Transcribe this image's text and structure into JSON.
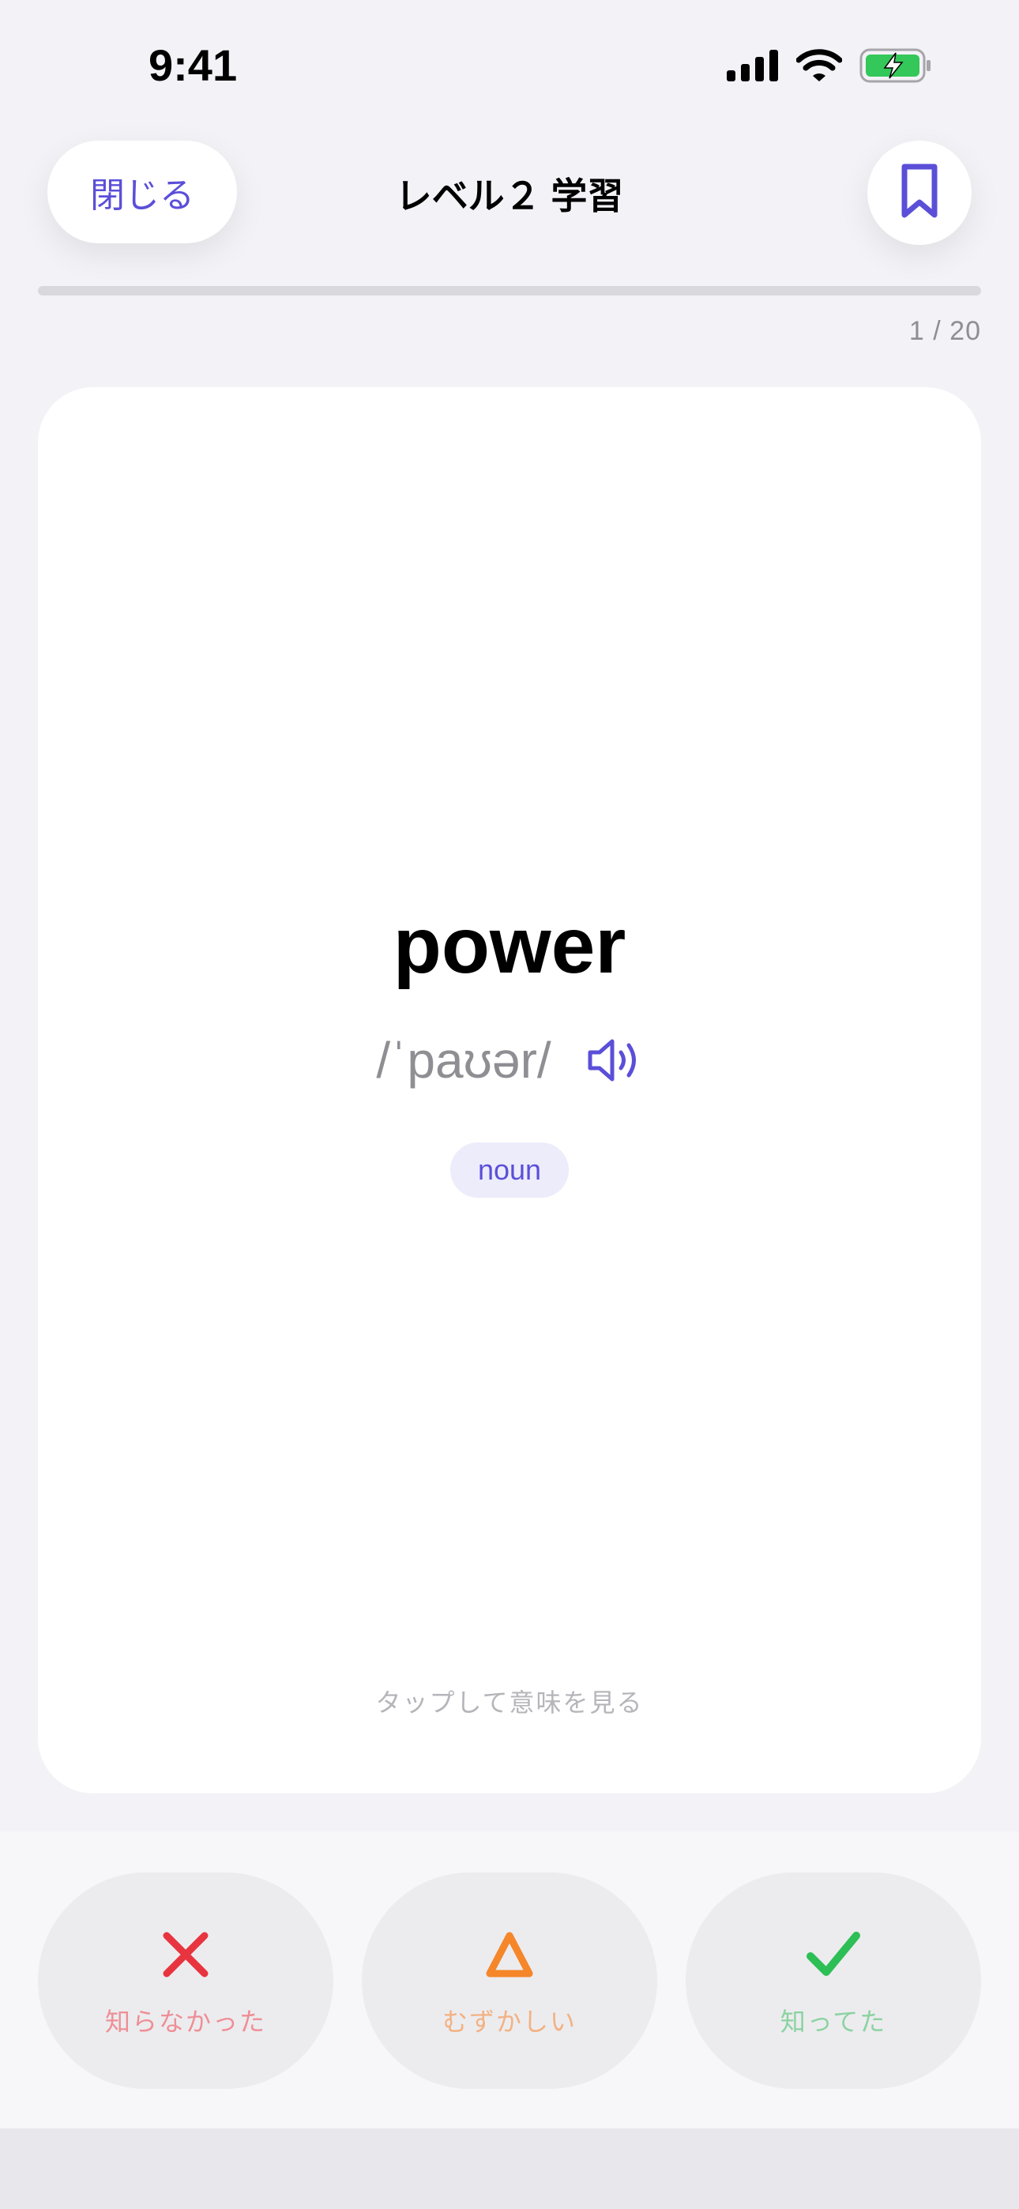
{
  "status_bar": {
    "time": "9:41",
    "icons": [
      "signal-icon",
      "wifi-icon",
      "battery-charging-icon"
    ]
  },
  "header": {
    "close_label": "閉じる",
    "title": "レベル２ 学習",
    "bookmark_icon": "bookmark-icon"
  },
  "progress": {
    "current": 1,
    "total": 20,
    "text": "1 / 20",
    "fraction": 0.0
  },
  "card": {
    "word": "power",
    "phonetic": "/ˈpaʊər/",
    "speaker_icon": "speaker-icon",
    "part_of_speech": "noun",
    "hint": "タップして意味を見る"
  },
  "actions": [
    {
      "label": "知らなかった",
      "icon": "x-icon",
      "color": "#e8343f",
      "label_color": "#ee8f95"
    },
    {
      "label": "むずかしい",
      "icon": "triangle-icon",
      "color": "#f5862a",
      "label_color": "#f3b182"
    },
    {
      "label": "知ってた",
      "icon": "check-icon",
      "color": "#2dbf56",
      "label_color": "#8bd3a0"
    }
  ],
  "colors": {
    "accent": "#5b4fd8",
    "background": "#f2f2f7"
  }
}
